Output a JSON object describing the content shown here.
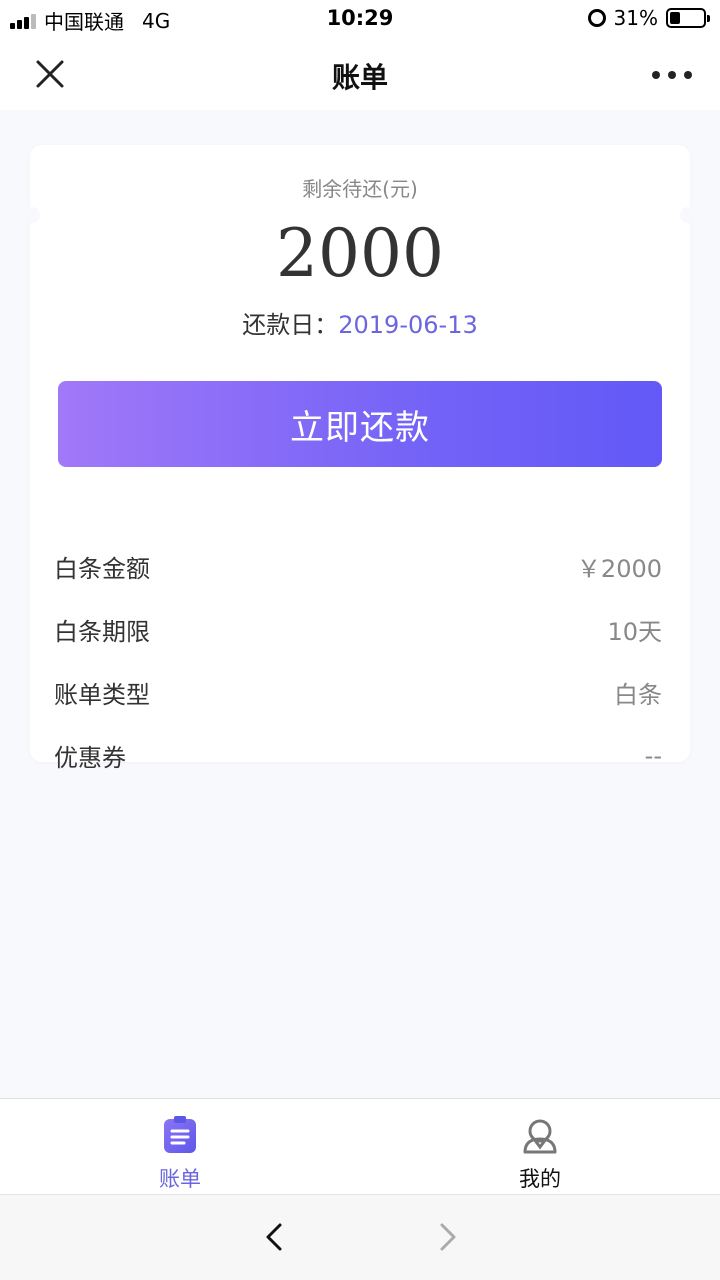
{
  "status_bar": {
    "carrier": "中国联通",
    "network": "4G",
    "time": "10:29",
    "battery": "31%",
    "battery_level": 0.31
  },
  "nav": {
    "title": "账单"
  },
  "bill": {
    "remain_label": "剩余待还(元)",
    "remain_amount": "2000",
    "due_label": "还款日：",
    "due_date": "2019-06-13",
    "pay_button": "立即还款",
    "rows": [
      {
        "label": "白条金额",
        "value": "￥2000"
      },
      {
        "label": "白条期限",
        "value": "10天"
      },
      {
        "label": "账单类型",
        "value": "白条"
      },
      {
        "label": "优惠券",
        "value": "--"
      }
    ]
  },
  "tabs": [
    {
      "label": "账单",
      "icon": "bill-icon",
      "active": true
    },
    {
      "label": "我的",
      "icon": "profile-icon",
      "active": false
    }
  ],
  "colors": {
    "accent": "#6b66e0",
    "button_gradient_start": "#a178f8",
    "button_gradient_end": "#6259f7"
  }
}
